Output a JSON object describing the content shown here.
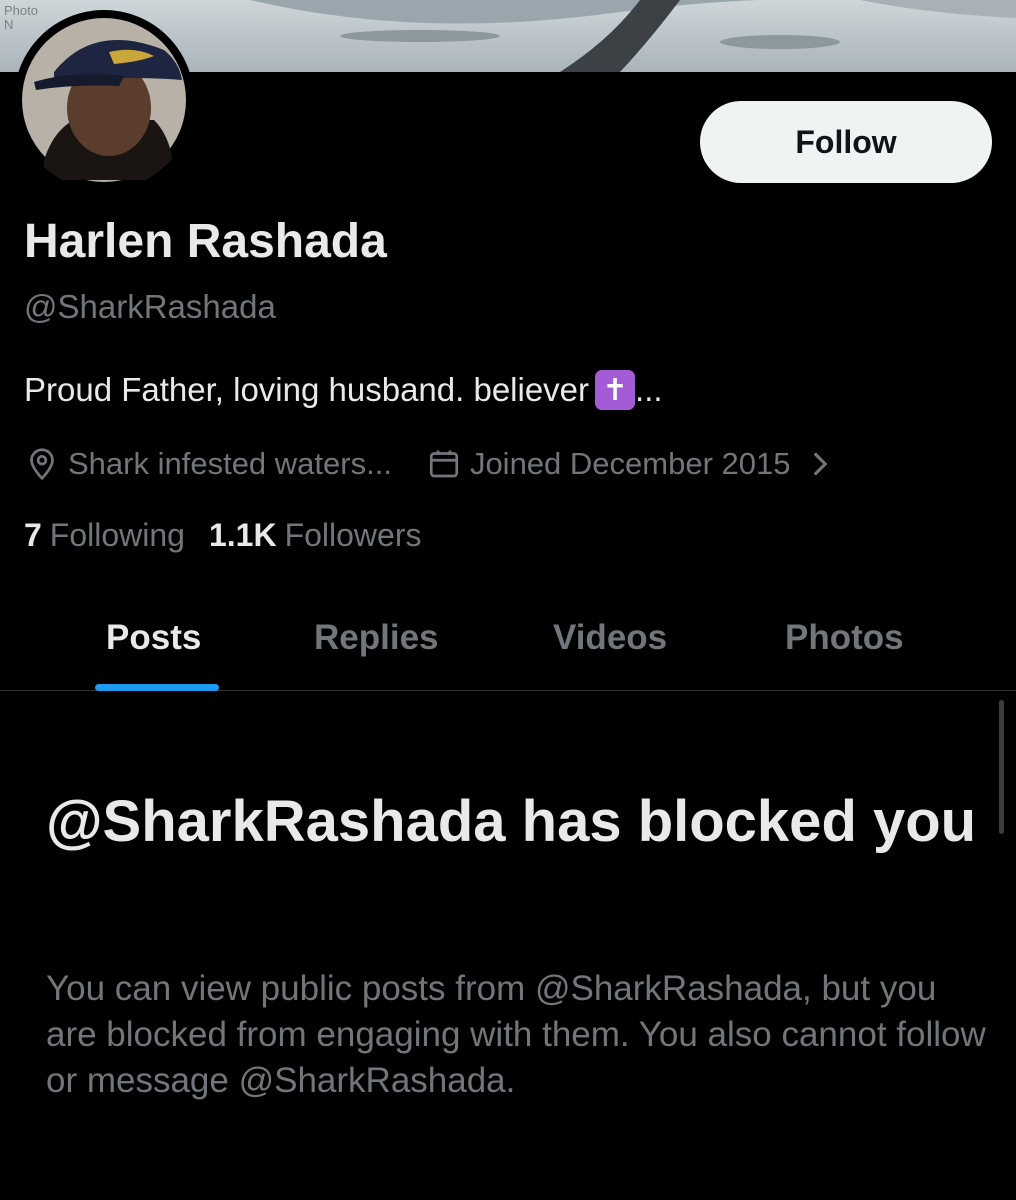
{
  "banner": {
    "credit_text": "Photo\nN"
  },
  "header": {
    "follow_label": "Follow"
  },
  "profile": {
    "display_name": "Harlen Rashada",
    "handle": "@SharkRashada",
    "bio": "Proud Father, loving husband. believer",
    "bio_emoji": "✝",
    "bio_suffix": "...",
    "location": "Shark infested waters...",
    "joined": "Joined December 2015",
    "following_count": "7",
    "following_label": "Following",
    "followers_count": "1.1K",
    "followers_label": "Followers"
  },
  "tabs": [
    {
      "label": "Posts",
      "active": true
    },
    {
      "label": "Replies",
      "active": false
    },
    {
      "label": "Videos",
      "active": false
    },
    {
      "label": "Photos",
      "active": false
    }
  ],
  "blocked": {
    "title": "@SharkRashada has blocked you",
    "body": "You can view public posts from @SharkRashada, but you are blocked from engaging with them. You also cannot follow or message @SharkRashada."
  },
  "colors": {
    "background": "#000000",
    "primary_text": "#e7e9ea",
    "secondary_text": "#71767b",
    "accent": "#1d9bf0",
    "follow_button_bg": "#eff3f4"
  },
  "icons": {
    "location": "location-pin-icon",
    "calendar": "calendar-icon",
    "chevron": "chevron-right-icon"
  }
}
